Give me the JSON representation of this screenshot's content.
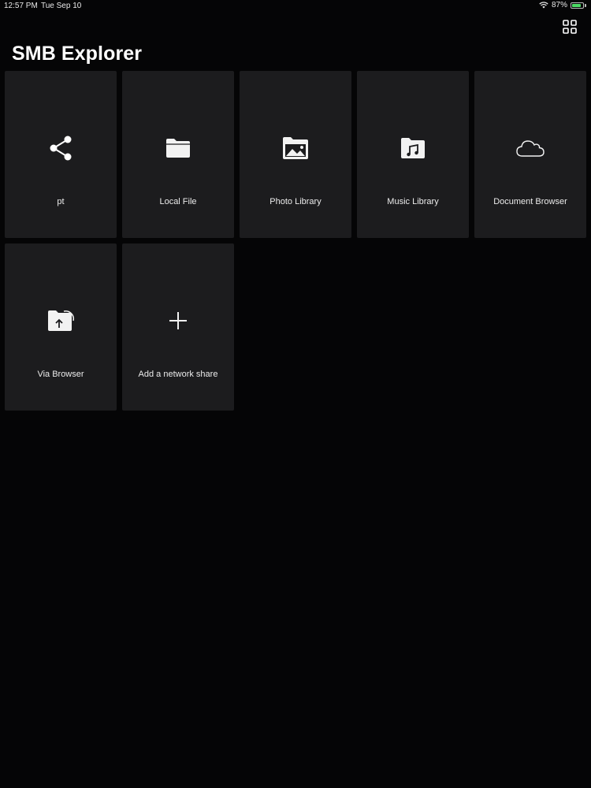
{
  "status_bar": {
    "time": "12:57 PM",
    "date": "Tue Sep 10",
    "battery": "87%",
    "battery_level": 0.87,
    "battery_color": "#4cd964"
  },
  "header": {
    "title": "SMB Explorer",
    "layout_toggle_icon": "grid-view-icon"
  },
  "tiles": [
    {
      "label": "pt",
      "icon": "share-icon"
    },
    {
      "label": "Local File",
      "icon": "folder-icon"
    },
    {
      "label": "Photo Library",
      "icon": "photo-folder-icon"
    },
    {
      "label": "Music Library",
      "icon": "music-folder-icon"
    },
    {
      "label": "Document Browser",
      "icon": "cloud-icon"
    },
    {
      "label": "Via Browser",
      "icon": "upload-folder-icon"
    },
    {
      "label": "Add a network share",
      "icon": "plus-icon"
    }
  ],
  "colors": {
    "background": "#050506",
    "tile": "#1c1c1e",
    "text": "#ffffff"
  }
}
